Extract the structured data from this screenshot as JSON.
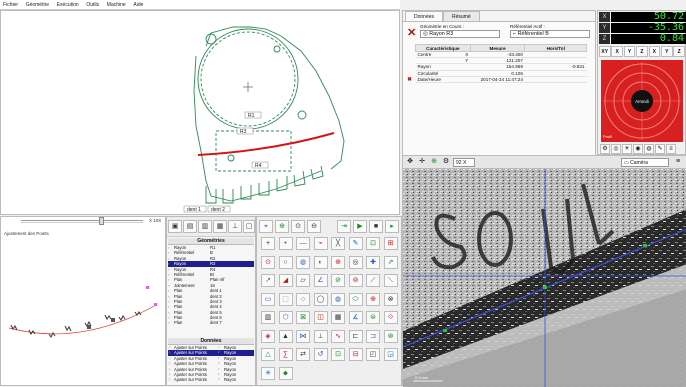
{
  "menu": [
    "Fichier",
    "Géométrie",
    "Exécution",
    "Outils",
    "Machine",
    "Aide"
  ],
  "drawing": {
    "labels": {
      "r1": "R1",
      "r3": "R3",
      "r4": "R4",
      "dent1": "dent 1",
      "dent2": "dent 2"
    }
  },
  "fit_panel": {
    "title": "Ajustement des Points",
    "zoom": "X 10X"
  },
  "geometries": {
    "title": "Géométries",
    "rows": [
      {
        "type": "Rayon",
        "name": "R1"
      },
      {
        "type": "Référentiel",
        "name": "B"
      },
      {
        "type": "Rayon",
        "name": "R2"
      },
      {
        "type": "Rayon",
        "name": "R3",
        "selected": true
      },
      {
        "type": "Rayon",
        "name": "R4"
      },
      {
        "type": "Référentiel",
        "name": "BI"
      },
      {
        "type": "Plan",
        "name": "Plan réf"
      },
      {
        "type": "Jointement",
        "name": "18"
      },
      {
        "type": "Plan",
        "name": "dent 1"
      },
      {
        "type": "Plan",
        "name": "dent 2"
      },
      {
        "type": "Plan",
        "name": "dent 3"
      },
      {
        "type": "Plan",
        "name": "dent 4"
      },
      {
        "type": "Plan",
        "name": "dent 5"
      },
      {
        "type": "Plan",
        "name": "dent 6"
      },
      {
        "type": "Plan",
        "name": "dent 7"
      }
    ]
  },
  "donnees": {
    "title": "Données",
    "rows": [
      {
        "action": "Ajuster sur Points",
        "target": "Rayon"
      },
      {
        "action": "Ajuster sur Points",
        "target": "Rayon",
        "selected": true
      },
      {
        "action": "Ajuster sur Points",
        "target": "Rayon"
      },
      {
        "action": "Ajuster sur Points",
        "target": "Rayon"
      },
      {
        "action": "Ajuster sur Points",
        "target": "Rayon"
      },
      {
        "action": "Ajuster sur Points",
        "target": "Rayon"
      },
      {
        "action": "Ajuster sur Points",
        "target": "Rayon"
      }
    ]
  },
  "results": {
    "tabs": [
      "Données",
      "Résumé"
    ],
    "geom_label": "Géométrie en Cours :",
    "geom_value": "Rayon R3",
    "ref_label": "Référentiel Actif :",
    "ref_value": "Référentiel B",
    "headers": [
      "Caractéristique",
      "Mesure",
      "Hors/Tol"
    ],
    "rows": [
      {
        "name": "Centre",
        "axis": "X",
        "value": "-33.400",
        "tol": ""
      },
      {
        "name": "",
        "axis": "Y",
        "value": "121.207",
        "tol": ""
      },
      {
        "name": "Rayon",
        "axis": "",
        "value": "154.969",
        "tol": "-0.831"
      },
      {
        "name": "Circularité",
        "axis": "",
        "value": "0.106",
        "tol": ""
      },
      {
        "name": "Date/Heure",
        "axis": "",
        "value": "2017-04-24 11:47:24",
        "tol": ""
      }
    ]
  },
  "dro": {
    "axes": [
      {
        "axis": "X",
        "value": "50.72"
      },
      {
        "axis": "Y",
        "value": "-35.36"
      },
      {
        "axis": "Z",
        "value": "0.84"
      }
    ],
    "buttons": [
      "XY",
      "X",
      "Y",
      "Z",
      "X",
      "Y",
      "Z"
    ],
    "joystick_center": "Arrondi",
    "joystick_corner": "Profil"
  },
  "camera": {
    "zoom": "92 X",
    "label": "Caméra",
    "scale": "0.5 mm"
  },
  "colors": {
    "drawing_line": "#2e8b57",
    "arc_red": "#d01818",
    "dro_text": "#2ee62e",
    "joystick_red": "#d82020",
    "crosshair_blue": "#3a4fe0",
    "fit_green": "#30c030"
  }
}
